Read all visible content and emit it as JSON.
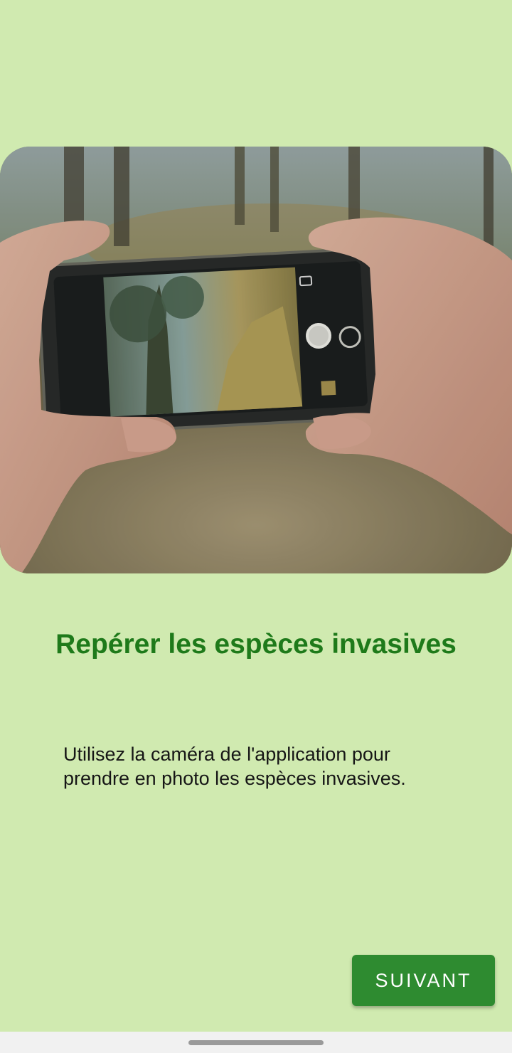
{
  "onboarding": {
    "image_alt": "hands-holding-phone-photo",
    "title": "Repérer les espèces invasives",
    "description": "Utilisez la caméra de l'application pour prendre en photo les espèces invasives.",
    "next_label": "SUIVANT"
  },
  "colors": {
    "background": "#d0eab0",
    "title": "#1e7a1a",
    "button": "#2e8b30",
    "nav_bar": "#f1f1f1"
  },
  "icons": {
    "home_indicator": "home-pill-icon"
  }
}
